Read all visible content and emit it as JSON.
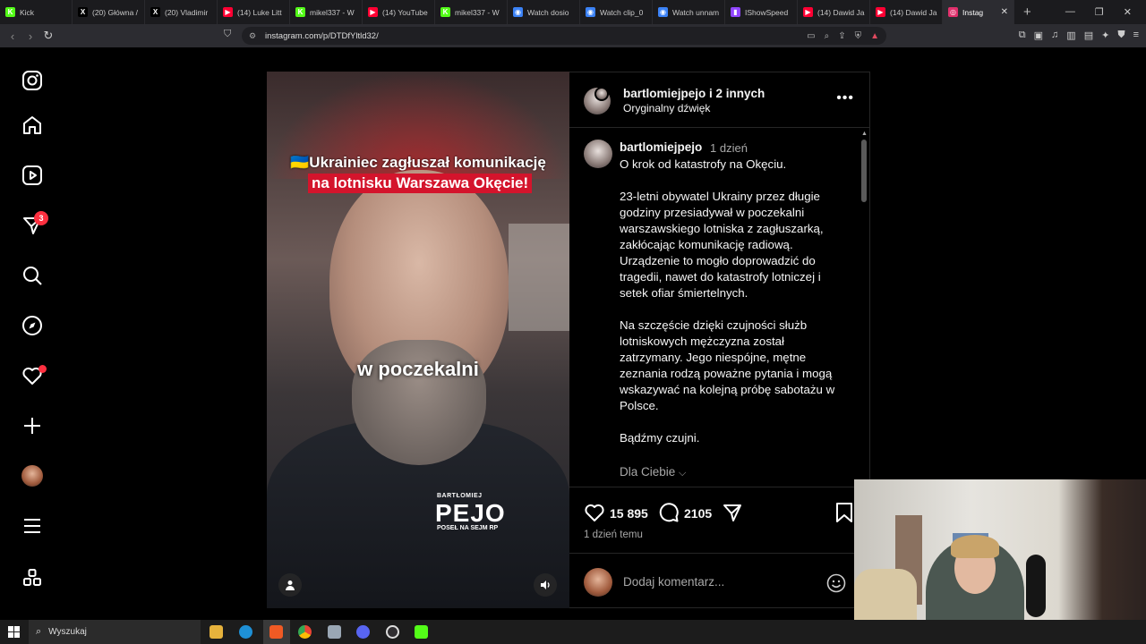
{
  "browser": {
    "tabs": [
      {
        "label": "Kick",
        "color": "#53fc18",
        "glyph": "K"
      },
      {
        "label": "(20) Główna /",
        "color": "#000000",
        "glyph": "X"
      },
      {
        "label": "(20) Vladimir",
        "color": "#000000",
        "glyph": "X"
      },
      {
        "label": "(14) Luke Litt",
        "color": "#ff0033",
        "glyph": "▶"
      },
      {
        "label": "mikel337 - W",
        "color": "#53fc18",
        "glyph": "K"
      },
      {
        "label": "(14) YouTube",
        "color": "#ff0033",
        "glyph": "▶"
      },
      {
        "label": "mikel337 - W",
        "color": "#53fc18",
        "glyph": "K"
      },
      {
        "label": "Watch dosio",
        "color": "#3b82f6",
        "glyph": "◉"
      },
      {
        "label": "Watch clip_0",
        "color": "#3b82f6",
        "glyph": "◉"
      },
      {
        "label": "Watch unnam",
        "color": "#3b82f6",
        "glyph": "◉"
      },
      {
        "label": "IShowSpeed",
        "color": "#9146ff",
        "glyph": "▮"
      },
      {
        "label": "(14) Dawid Ja",
        "color": "#ff0033",
        "glyph": "▶"
      },
      {
        "label": "(14) Dawid Ja",
        "color": "#ff0033",
        "glyph": "▶"
      },
      {
        "label": "Instag",
        "color": "#e1306c",
        "glyph": "◎"
      }
    ],
    "url": "instagram.com/p/DTDfYltld32/"
  },
  "sidebar": {
    "notifications_badge": "3"
  },
  "video": {
    "title_line1": "🇺🇦Ukrainiec zagłuszał komunikację",
    "title_line2": "na lotnisku Warszawa Okęcie!",
    "caption": "w poczekalni",
    "logo_top": "BARTŁOMIEJ",
    "logo_main": "PEJO",
    "logo_sub": "POSEŁ NA SEJM RP"
  },
  "post": {
    "header_user": "bartlomiejpejo i 2 innych",
    "header_sound": "Oryginalny dźwięk",
    "comment_user": "bartlomiejpejo",
    "comment_time": "1 dzień",
    "paragraphs": [
      "O krok od katastrofy na Okęciu.",
      "23-letni obywatel Ukrainy przez długie godziny przesiadywał w poczekalni warszawskiego lotniska z zagłuszarką, zakłócając komunikację radiową. Urządzenie to mogło doprowadzić do tragedii, nawet do katastrofy lotniczej i setek ofiar śmiertelnych.",
      "Na szczęście dzięki czujności służb lotniskowych mężczyzna został zatrzymany. Jego niespójne, mętne zeznania rodzą poważne pytania i mogą wskazywać na kolejną próbę sabotażu w Polsce.",
      "Bądźmy czujni."
    ],
    "for_you": "Dla Ciebie",
    "likes": "15 895",
    "comments": "2105",
    "date": "1 dzień temu",
    "comment_placeholder": "Dodaj komentarz..."
  },
  "taskbar": {
    "search_placeholder": "Wyszukaj"
  }
}
